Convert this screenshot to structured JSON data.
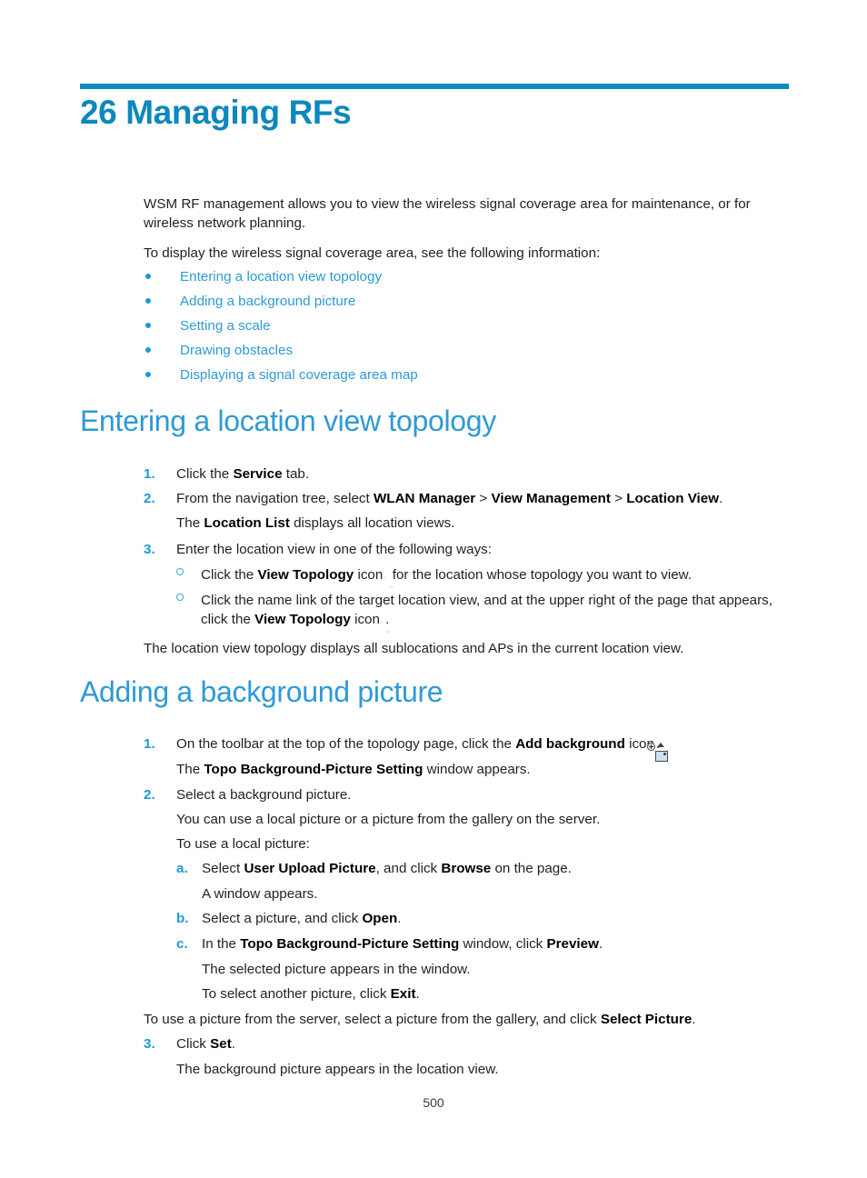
{
  "document": {
    "chapter_title": "26 Managing RFs",
    "page_number": "500"
  },
  "intro": {
    "paragraph_1": "WSM RF management allows you to view the wireless signal coverage area for maintenance, or for wireless network planning.",
    "paragraph_2": "To display the wireless signal coverage area, see the following information:"
  },
  "link_list": [
    {
      "label": "Entering a location view topology"
    },
    {
      "label": "Adding a background picture"
    },
    {
      "label": "Setting a scale"
    },
    {
      "label": "Drawing obstacles"
    },
    {
      "label": "Displaying a signal coverage area map"
    }
  ],
  "section_topology": {
    "heading": "Entering a location view topology",
    "step1": {
      "num": "1.",
      "text_before": "Click the ",
      "bold_1": "Service",
      "text_after": " tab."
    },
    "step2": {
      "num": "2.",
      "text_before": "From the navigation tree, select ",
      "bold_1": "WLAN Manager",
      "sep_1": " > ",
      "bold_2": "View Management",
      "sep_2": " > ",
      "bold_3": "Location View",
      "text_after": ".",
      "followup_before": "The ",
      "followup_bold": "Location List",
      "followup_after": " displays all location views."
    },
    "step3": {
      "num": "3.",
      "text": "Enter the location view in one of the following ways:",
      "option_a": {
        "text_before": "Click the ",
        "bold_1": "View Topology",
        "text_mid": " icon ",
        "icon": "view-topology-icon",
        "text_after": " for the location whose topology you want to view."
      },
      "option_b": {
        "text_before": "Click the name link of the target location view, and at the upper right of the page that appears, click the ",
        "bold_1": "View Topology",
        "text_mid": " icon ",
        "icon": "view-topology-icon",
        "text_after": "."
      }
    },
    "closing": "The location view topology displays all sublocations and APs in the current location view."
  },
  "section_background": {
    "heading": "Adding a background picture",
    "step1": {
      "num": "1.",
      "text_before": "On the toolbar at the top of the topology page, click the ",
      "bold_1": "Add background",
      "text_mid": " icon",
      "icon": "add-background-icon",
      "text_after": ".",
      "followup_before": "The ",
      "followup_bold": "Topo Background-Picture Setting",
      "followup_after": " window appears."
    },
    "step2": {
      "num": "2.",
      "text": "Select a background picture.",
      "line_2": "You can use a local picture or a picture from the gallery on the server.",
      "line_3": "To use a local picture:",
      "sub_a": {
        "marker": "a.",
        "text_before": "Select ",
        "bold_1": "User Upload Picture",
        "text_mid": ", and click ",
        "bold_2": "Browse",
        "text_after": " on the page.",
        "followup": "A window appears."
      },
      "sub_b": {
        "marker": "b.",
        "text_before": "Select a picture, and click ",
        "bold_1": "Open",
        "text_after": "."
      },
      "sub_c": {
        "marker": "c.",
        "text_before": "In the ",
        "bold_1": "Topo Background-Picture Setting",
        "text_mid": " window, click ",
        "bold_2": "Preview",
        "text_after": ".",
        "followup_1": "The selected picture appears in the window.",
        "followup_2_before": "To select another picture, click ",
        "followup_2_bold": "Exit",
        "followup_2_after": "."
      },
      "line_server_before": "To use a picture from the server, select a picture from the gallery, and click ",
      "line_server_bold": "Select Picture",
      "line_server_after": "."
    },
    "step3": {
      "num": "3.",
      "text_before": "Click ",
      "bold_1": "Set",
      "text_after": ".",
      "followup": "The background picture appears in the location view."
    }
  },
  "colors": {
    "chapter_blue": "#0d87be",
    "rule_blue": "#0b8cc0",
    "heading_blue": "#2e9ad4",
    "link_blue": "#2e9ad4",
    "body_black": "#231f20"
  }
}
